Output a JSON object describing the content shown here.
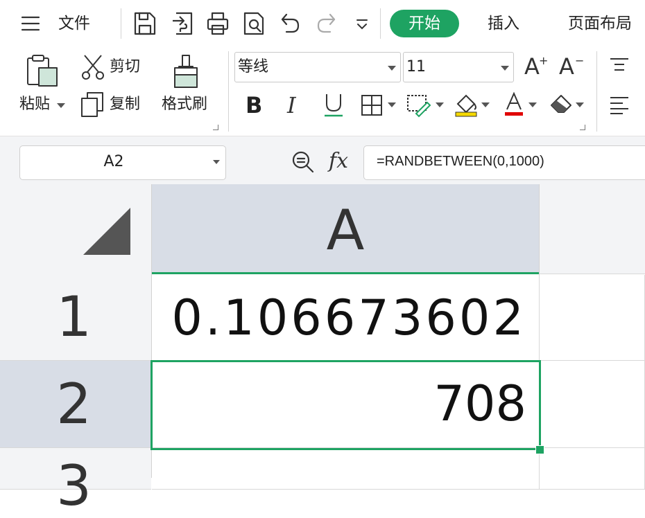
{
  "menubar": {
    "file_label": "文件",
    "tabs": [
      {
        "label": "开始",
        "active": true
      },
      {
        "label": "插入",
        "active": false
      },
      {
        "label": "页面布局",
        "active": false
      }
    ],
    "quick_icons": [
      "menu-icon",
      "save-icon",
      "export-icon",
      "print-icon",
      "print-preview-icon",
      "undo-icon",
      "redo-icon",
      "more-dropdown-icon"
    ]
  },
  "ribbon": {
    "paste_label": "粘贴",
    "cut_label": "剪切",
    "copy_label": "复制",
    "format_painter_label": "格式刷",
    "font_name": "等线",
    "font_size": "11",
    "icons": [
      "paste-icon",
      "scissors-icon",
      "copy-icon",
      "format-painter-icon",
      "increase-font-icon",
      "decrease-font-icon",
      "bold-icon",
      "italic-icon",
      "underline-icon",
      "borders-icon",
      "cell-style-icon",
      "fill-color-icon",
      "font-color-icon",
      "clear-icon",
      "align-top-icon",
      "align-left-icon"
    ],
    "bold_glyph": "B",
    "italic_glyph": "I",
    "increase_glyph": "A",
    "decrease_glyph": "A"
  },
  "formula_bar": {
    "name_box": "A2",
    "fx_label": "fx",
    "formula": "=RANDBETWEEN(0,1000)"
  },
  "sheet": {
    "columns": [
      "A"
    ],
    "rows": [
      {
        "num": "1",
        "A": "0.106673602"
      },
      {
        "num": "2",
        "A": "708"
      },
      {
        "num": "3",
        "A": ""
      }
    ],
    "selected_cell": "A2"
  },
  "colors": {
    "accent": "#1ea362",
    "header_selected": "#d8dde6",
    "header_bg": "#f3f4f6",
    "fill_yellow": "#f5d800",
    "font_red": "#e00000"
  }
}
